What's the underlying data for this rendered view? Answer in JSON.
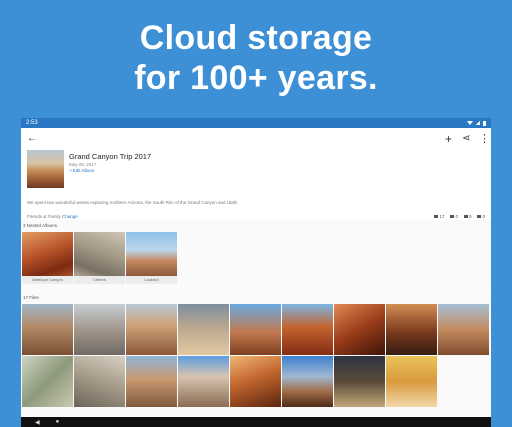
{
  "hero": {
    "line1": "Cloud storage",
    "line2": "for 100+ years."
  },
  "status_bar": {
    "time": "2:53"
  },
  "toolbar": {
    "back_icon": "arrow-left-icon",
    "add_icon": "plus-icon",
    "share_icon": "share-icon",
    "more_icon": "more-vert-icon"
  },
  "album": {
    "title": "Grand Canyon Trip 2017",
    "date": "May 08, 2017",
    "edit_label": "✓Edit Album",
    "description": "We spent two wonderful weeks exploring northern Arizona, the South Rim of the Grand Canyon and Utah!",
    "share_label": "Friends & Family",
    "change_label": "Change",
    "stats": {
      "photos": "17",
      "videos": "0",
      "comments": "0",
      "files": "0"
    }
  },
  "nested": {
    "title": "3 Nested Albums",
    "items": [
      {
        "label": "Antelope Canyon"
      },
      {
        "label": "Critters"
      },
      {
        "label": "Lookout"
      }
    ]
  },
  "files": {
    "title": "17 Files",
    "count": 17
  },
  "colors": {
    "background": "#3d8fd6",
    "accent": "#2a78c5"
  }
}
